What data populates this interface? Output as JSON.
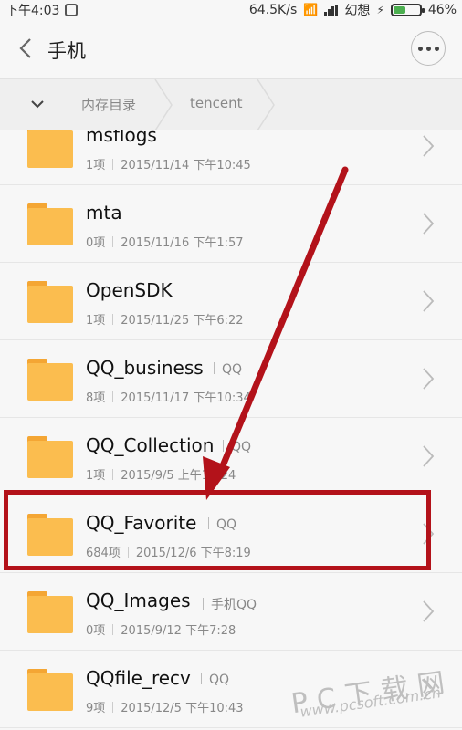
{
  "status_bar": {
    "time": "下午4:03",
    "net_speed": "64.5K/s",
    "carrier": "幻想",
    "battery": "46%",
    "battery_level": 0.46
  },
  "header": {
    "title": "手机"
  },
  "breadcrumb": {
    "items": [
      "内存目录",
      "tencent"
    ]
  },
  "files": [
    {
      "name": "msflogs",
      "tag": "",
      "count": "1项",
      "date": "2015/11/14 下午10:45"
    },
    {
      "name": "mta",
      "tag": "",
      "count": "0项",
      "date": "2015/11/16 下午1:57"
    },
    {
      "name": "OpenSDK",
      "tag": "",
      "count": "1项",
      "date": "2015/11/25 下午6:22"
    },
    {
      "name": "QQ_business",
      "tag": "QQ",
      "count": "8项",
      "date": "2015/11/17 下午10:34"
    },
    {
      "name": "QQ_Collection",
      "tag": "QQ",
      "count": "1项",
      "date": "2015/9/5 上午10:24"
    },
    {
      "name": "QQ_Favorite",
      "tag": "QQ",
      "count": "684项",
      "date": "2015/12/6 下午8:19"
    },
    {
      "name": "QQ_Images",
      "tag": "手机QQ",
      "count": "0项",
      "date": "2015/9/12 下午7:28"
    },
    {
      "name": "QQfile_recv",
      "tag": "QQ",
      "count": "9项",
      "date": "2015/12/5 下午10:43"
    }
  ],
  "watermark": {
    "title": "PC下载网",
    "url": "www.pcsoft.com.cn"
  },
  "colors": {
    "folder": "#fbbd4f",
    "folder_tab": "#f4a634",
    "highlight": "#b3121a",
    "battery": "#4caf50"
  }
}
